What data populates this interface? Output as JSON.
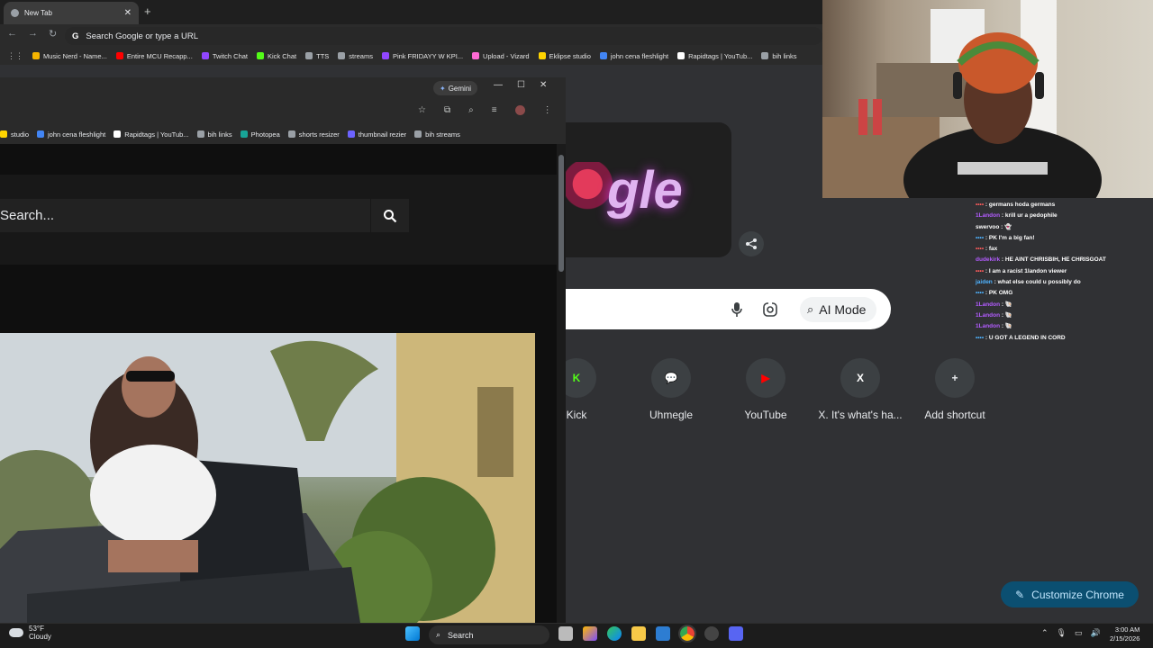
{
  "chrome": {
    "tab_title": "New Tab",
    "tab_close": "✕",
    "new_tab": "+",
    "nav_back": "←",
    "nav_forward": "→",
    "nav_reload": "↻",
    "omnibox_placeholder": "Search Google or type a URL",
    "apps_icon": "⋮⋮",
    "bookmarks": [
      {
        "label": "Music Nerd - Name...",
        "color": "#f5b400"
      },
      {
        "label": "Entire MCU Recapp...",
        "color": "#ff0000"
      },
      {
        "label": "Twitch Chat",
        "color": "#9146ff"
      },
      {
        "label": "Kick Chat",
        "color": "#53fc18"
      },
      {
        "label": "TTS",
        "color": "#9aa0a6"
      },
      {
        "label": "streams",
        "color": "#9aa0a6"
      },
      {
        "label": "Pink FRIDAYY W KPI...",
        "color": "#9146ff"
      },
      {
        "label": "Upload - Vizard",
        "color": "#ff6ad5"
      },
      {
        "label": "Eklipse studio",
        "color": "#ffd400"
      },
      {
        "label": "john cena fleshlight",
        "color": "#4285f4"
      },
      {
        "label": "Rapidtags | YouTub...",
        "color": "#ffffff"
      },
      {
        "label": "bih links",
        "color": "#9aa0a6"
      }
    ]
  },
  "ntp": {
    "doodle_text": "gle",
    "share_icon": "share-icon",
    "ai_mode_label": "AI Mode",
    "shortcuts": [
      {
        "label": "Kick",
        "glyph": "K",
        "color": "#53fc18"
      },
      {
        "label": "Uhmegle",
        "glyph": "💬",
        "color": "#4c8dff"
      },
      {
        "label": "YouTube",
        "glyph": "▶",
        "color": "#ff0000"
      },
      {
        "label": "X. It's what's ha...",
        "glyph": "X",
        "color": "#ffffff"
      },
      {
        "label": "Add shortcut",
        "glyph": "+",
        "color": "#e8eaed"
      }
    ],
    "customize_label": "Customize Chrome"
  },
  "floating_window": {
    "gemini_label": "Gemini",
    "minimize": "—",
    "maximize": "☐",
    "close": "✕",
    "bookmarks": [
      {
        "label": "studio",
        "color": "#ffd400"
      },
      {
        "label": "john cena fleshlight",
        "color": "#4285f4"
      },
      {
        "label": "Rapidtags | YouTub...",
        "color": "#ffffff"
      },
      {
        "label": "bih links",
        "color": "#9aa0a6"
      },
      {
        "label": "Photopea",
        "color": "#18a497"
      },
      {
        "label": "shorts resizer",
        "color": "#9aa0a6"
      },
      {
        "label": "thumbnail rezier",
        "color": "#6c63ff"
      },
      {
        "label": "bih streams",
        "color": "#9aa0a6"
      }
    ],
    "search_placeholder": "Search..."
  },
  "chat": [
    {
      "user": "",
      "msg": ": germans hoda germans",
      "color": "#ff5c5c"
    },
    {
      "user": "1Landon",
      "msg": ": krill ur a pedophile",
      "color": "#b35cff"
    },
    {
      "user": "swervoo",
      "msg": ": 👻",
      "color": "#ffffff"
    },
    {
      "user": "",
      "msg": ": PK I'm a big fan!",
      "color": "#4fb3ff"
    },
    {
      "user": "",
      "msg": ": fax",
      "color": "#ff5c5c"
    },
    {
      "user": "dudekirk",
      "msg": ": HE AINT CHRISBIH, HE CHRISGOAT",
      "color": "#b35cff"
    },
    {
      "user": "",
      "msg": ": I am a racist 1landon viewer",
      "color": "#ff5c5c"
    },
    {
      "user": "jaiden",
      "msg": ": what else could u possibly do",
      "color": "#4fb3ff"
    },
    {
      "user": "",
      "msg": ": PK OMG",
      "color": "#4fb3ff"
    },
    {
      "user": "1Landon",
      "msg": ": 🐚",
      "color": "#b35cff"
    },
    {
      "user": "1Landon",
      "msg": ": 🐚",
      "color": "#b35cff"
    },
    {
      "user": "1Landon",
      "msg": ": 🐚",
      "color": "#b35cff"
    },
    {
      "user": "",
      "msg": ": U GOT A LEGEND IN CORD",
      "color": "#4fb3ff"
    }
  ],
  "taskbar": {
    "temp": "53°F",
    "weather": "Cloudy",
    "search_label": "Search",
    "time": "3:00 AM",
    "date": "2/15/2026"
  }
}
